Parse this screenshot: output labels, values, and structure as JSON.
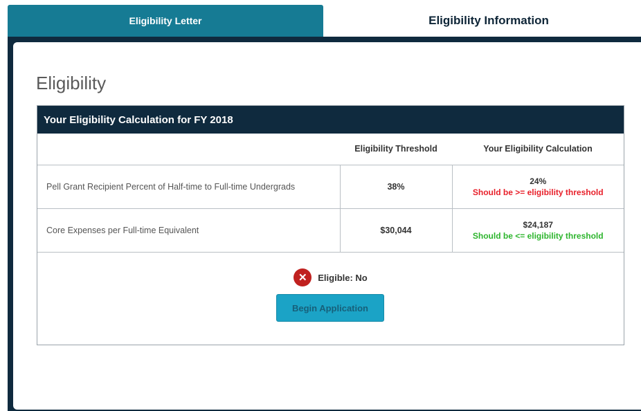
{
  "tabs": [
    {
      "label": "Eligibility Letter"
    },
    {
      "label": "Eligibility Information"
    }
  ],
  "page_title": "Eligibility",
  "card": {
    "title": "Your Eligibility Calculation for FY 2018",
    "columns": [
      "",
      "Eligibility Threshold",
      "Your Eligibility Calculation"
    ],
    "rows": [
      {
        "label": "Pell Grant Recipient Percent of Half-time to Full-time Undergrads",
        "threshold": "38%",
        "calculation": "24%",
        "note": "Should be >= eligibility threshold",
        "note_status": "fail"
      },
      {
        "label": "Core Expenses per Full-time Equivalent",
        "threshold": "$30,044",
        "calculation": "$24,187",
        "note": "Should be <= eligibility threshold",
        "note_status": "pass"
      }
    ]
  },
  "status": {
    "icon": "x-circle-icon",
    "text": "Eligible: No"
  },
  "begin_button": {
    "label": "Begin Application"
  },
  "colors": {
    "navy": "#0f2a3e",
    "teal": "#167b94",
    "button": "#1ba3c6",
    "fail": "#e8202a",
    "pass": "#2db52d"
  }
}
